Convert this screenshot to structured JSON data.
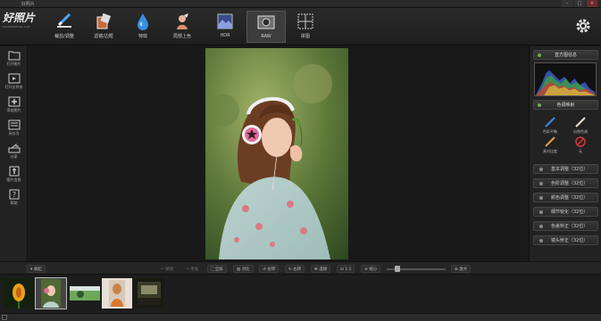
{
  "window": {
    "title": "好照片"
  },
  "app": {
    "logo_text": "好照片",
    "logo_sub": "HAOZHAOPIAN.COM"
  },
  "toolbar": {
    "tools": [
      {
        "label": "裁剪/调整",
        "icon": "crop-adjust-icon"
      },
      {
        "label": "滤镜/边框",
        "icon": "filter-frame-icon"
      },
      {
        "label": "特效",
        "icon": "effects-drop-icon"
      },
      {
        "label": "局部上色",
        "icon": "local-color-icon"
      },
      {
        "label": "HDR",
        "icon": "hdr-icon"
      },
      {
        "label": "RAW",
        "icon": "raw-icon"
      },
      {
        "label": "拼图",
        "icon": "collage-icon"
      }
    ],
    "selected": "RAW"
  },
  "left_panel": {
    "items": [
      {
        "label": "打开图片",
        "icon": "open-folder-icon"
      },
      {
        "label": "打开文件夹",
        "icon": "open-folder-video-icon"
      },
      {
        "label": "添加图片",
        "icon": "add-image-icon"
      },
      {
        "label": "另存为",
        "icon": "save-as-icon"
      },
      {
        "label": "分享",
        "icon": "share-icon"
      },
      {
        "label": "图片信息",
        "icon": "image-info-icon"
      },
      {
        "label": "帮助",
        "icon": "help-icon"
      }
    ]
  },
  "right_panel": {
    "histogram_title": "直方图信息",
    "tone_title": "色调映射",
    "tone_options": [
      {
        "label": "色彩平衡",
        "icon": "brush-blue-icon"
      },
      {
        "label": "自然色调",
        "icon": "brush-white-icon"
      },
      {
        "label": "高对比度",
        "icon": "brush-orange-icon"
      },
      {
        "label": "无",
        "icon": "none-circle-icon"
      }
    ],
    "adjust_items": [
      "基本调整（32位）",
      "色阶调整（32位）",
      "颜色调整（32位）",
      "细节锐化（32位）",
      "色差矫正（32位）",
      "镜头矫正（32位）"
    ]
  },
  "bottom_bar": {
    "collapse": "收起",
    "undo": "撤销",
    "redo": "重做",
    "fullscreen": "全屏",
    "compare": "对比",
    "rotate_left": "左转",
    "rotate_right": "右转",
    "flip": "选择",
    "actual_size": "1:1",
    "zoom_out": "缩小",
    "zoom_in": "放大",
    "zoom_fraction": 0.15
  },
  "filmstrip": {
    "thumbs": [
      "flower",
      "woman-headphones",
      "green-landscape",
      "portrait-orange",
      "dark-scene"
    ],
    "selected_index": 1
  },
  "colors": {
    "accent_green": "#6ab04c",
    "background": "#1b1b1b"
  }
}
